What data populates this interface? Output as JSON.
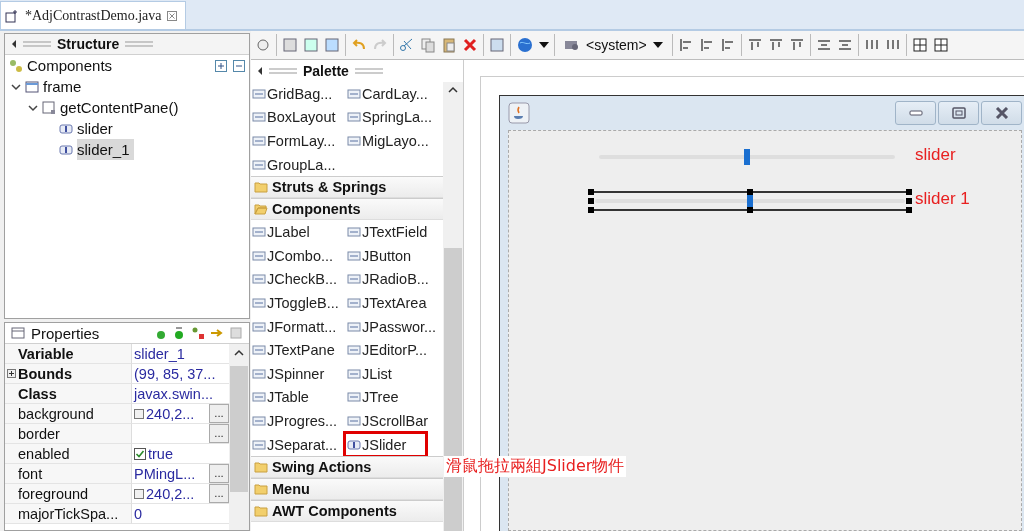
{
  "editor_tab": {
    "title": "*AdjContrastDemo.java",
    "selected": true
  },
  "structure": {
    "title": "Structure",
    "components_label": "Components",
    "tree": [
      {
        "label": "frame",
        "expanded": true,
        "selected": false,
        "children": [
          {
            "label": "getContentPane()",
            "expanded": true,
            "selected": false,
            "children": [
              {
                "label": "slider",
                "selected": false
              },
              {
                "label": "slider_1",
                "selected": true
              }
            ]
          }
        ]
      }
    ]
  },
  "properties": {
    "title": "Properties",
    "rows": [
      {
        "name": "Variable",
        "value": "slider_1",
        "bold": true,
        "kind": "text"
      },
      {
        "name": "Bounds",
        "value": "(99, 85, 37...",
        "bold": true,
        "kind": "text",
        "expandable": true
      },
      {
        "name": "Class",
        "value": "javax.swin...",
        "bold": true,
        "kind": "text"
      },
      {
        "name": "background",
        "value": "240,2...",
        "bold": false,
        "kind": "color",
        "button": "..."
      },
      {
        "name": "border",
        "bold": false,
        "kind": "text",
        "button": "..."
      },
      {
        "name": "enabled",
        "value": "true",
        "bold": false,
        "kind": "checkbox",
        "checked": true
      },
      {
        "name": "font",
        "value": "PMingL...",
        "bold": false,
        "kind": "text",
        "button": "..."
      },
      {
        "name": "foreground",
        "value": "240,2...",
        "bold": false,
        "kind": "color",
        "button": "..."
      },
      {
        "name": "majorTickSpa...",
        "value": "0",
        "bold": false,
        "kind": "text"
      }
    ]
  },
  "toolbar": {
    "system_dropdown": "<system>"
  },
  "palette": {
    "title": "Palette",
    "entries": [
      {
        "kind": "items",
        "items": [
          {
            "label": "GridBag..."
          },
          {
            "label": "CardLay..."
          },
          {
            "label": "BoxLayout"
          },
          {
            "label": "SpringLa..."
          },
          {
            "label": "FormLay..."
          },
          {
            "label": "MigLayo..."
          },
          {
            "label": "GroupLa..."
          }
        ]
      },
      {
        "kind": "category",
        "label": "Struts & Springs",
        "expanded": false
      },
      {
        "kind": "category",
        "label": "Components",
        "expanded": true
      },
      {
        "kind": "items",
        "items": [
          {
            "label": "JLabel"
          },
          {
            "label": "JTextField"
          },
          {
            "label": "JCombo..."
          },
          {
            "label": "JButton"
          },
          {
            "label": "JCheckB..."
          },
          {
            "label": "JRadioB..."
          },
          {
            "label": "JToggleB..."
          },
          {
            "label": "JTextArea"
          },
          {
            "label": "JFormatt..."
          },
          {
            "label": "JPasswor..."
          },
          {
            "label": "JTextPane"
          },
          {
            "label": "JEditorP..."
          },
          {
            "label": "JSpinner"
          },
          {
            "label": "JList"
          },
          {
            "label": "JTable"
          },
          {
            "label": "JTree"
          },
          {
            "label": "JProgres..."
          },
          {
            "label": "JScrollBar"
          },
          {
            "label": "JSeparat..."
          },
          {
            "label": "JSlider",
            "highlighted": true
          }
        ]
      },
      {
        "kind": "category",
        "label": "Swing Actions",
        "expanded": false
      },
      {
        "kind": "category",
        "label": "Menu",
        "expanded": false
      },
      {
        "kind": "category",
        "label": "AWT Components",
        "expanded": false
      }
    ]
  },
  "design": {
    "sliders": [
      {
        "level": 0.5,
        "selected": false,
        "note": "slider"
      },
      {
        "level": 0.5,
        "selected": true,
        "note": "slider 1"
      }
    ]
  },
  "annotation": "滑鼠拖拉兩組JSlider物件"
}
